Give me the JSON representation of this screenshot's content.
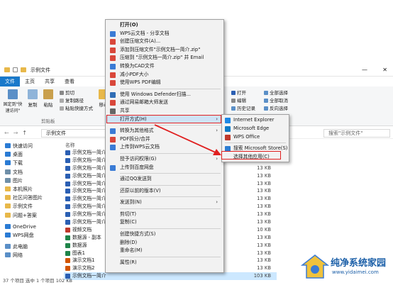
{
  "window": {
    "title": "示例文件",
    "tabs": [
      "文件",
      "主页",
      "共享",
      "查看"
    ]
  },
  "ribbon": {
    "pin_label": "固定到\"快速访问\"",
    "copy_label": "复制",
    "paste_label": "粘贴",
    "copy_path_label": "复制路径",
    "paste_shortcut_label": "粘贴快捷方式",
    "cut_label": "剪切",
    "move_label": "移动",
    "clipboard_group": "剪贴板",
    "open_label": "打开",
    "edit_label": "编辑",
    "history_label": "历史记录",
    "select_all_label": "全部选择",
    "select_none_label": "全部取消",
    "invert_label": "反向选择",
    "select_group": "选择"
  },
  "address": {
    "path": "示例文件",
    "search_placeholder": "搜索\"示例文件\""
  },
  "sidebar": {
    "items": [
      {
        "label": "快速访问",
        "color": "#2a7bd4"
      },
      {
        "label": "桌面",
        "color": "#2a7bd4"
      },
      {
        "label": "下载",
        "color": "#2a7bd4"
      },
      {
        "label": "文档",
        "color": "#6f8fa8"
      },
      {
        "label": "图片",
        "color": "#6f8fa8"
      },
      {
        "label": "本机照片",
        "color": "#e8b84a"
      },
      {
        "label": "社区问答图片",
        "color": "#e8b84a"
      },
      {
        "label": "示例文件",
        "color": "#e8b84a"
      },
      {
        "label": "问题+答案",
        "color": "#e8b84a"
      },
      {
        "label": "OneDrive",
        "color": "#2a7bd4"
      },
      {
        "label": "WPS网盘",
        "color": "#2a7bd4"
      },
      {
        "label": "此电脑",
        "color": "#5a8fc7"
      },
      {
        "label": "网络",
        "color": "#5a8fc7"
      }
    ]
  },
  "files": {
    "header": "名称",
    "rows": [
      {
        "name": "示例文档一简介",
        "size": "13 KB",
        "color": "#2b5fb3"
      },
      {
        "name": "示例文档一简介",
        "size": "13 KB",
        "color": "#2b5fb3"
      },
      {
        "name": "示例文档一简介",
        "size": "13 KB",
        "color": "#2b5fb3"
      },
      {
        "name": "示例文档一简介",
        "size": "13 KB",
        "color": "#2b5fb3"
      },
      {
        "name": "示例文档一简介",
        "size": "13 KB",
        "color": "#2b5fb3"
      },
      {
        "name": "示例文档一简介",
        "size": "13 KB",
        "color": "#2b5fb3"
      },
      {
        "name": "示例文档一简介",
        "size": "13 KB",
        "color": "#2b5fb3"
      },
      {
        "name": "示例文档一简介",
        "size": "13 KB",
        "color": "#2b5fb3"
      },
      {
        "name": "示例文档一简介",
        "size": "13 KB",
        "color": "#2b5fb3"
      },
      {
        "name": "示例文档一简介",
        "size": "13 KB",
        "color": "#2b5fb3"
      },
      {
        "name": "视频文档",
        "size": "10 KB",
        "color": "#c0392b"
      },
      {
        "name": "数据源 - 副本",
        "size": "13 KB",
        "color": "#1e8449"
      },
      {
        "name": "数据源",
        "size": "13 KB",
        "color": "#1e8449"
      },
      {
        "name": "图表1",
        "size": "13 KB",
        "color": "#1e8449"
      },
      {
        "name": "演示文档1",
        "size": "13 KB",
        "color": "#d35400"
      },
      {
        "name": "演示文档2",
        "size": "13 KB",
        "color": "#d35400"
      },
      {
        "name": "示例文档一简介",
        "size": "103 KB",
        "color": "#2b5fb3"
      }
    ]
  },
  "status": {
    "text": "37 个项目    选中 1 个项目  102 KB"
  },
  "context_menu": {
    "items": [
      {
        "label": "打开(O)",
        "color": "",
        "type": "bold"
      },
      {
        "label": "WPS云文档 - 分享文档",
        "color": "#3a7bd5"
      },
      {
        "label": "创建压缩文件(A)...",
        "color": "#d9473a"
      },
      {
        "label": "添加到压缩文件\"示例文档一简介.zip\"",
        "color": "#d9473a"
      },
      {
        "label": "压缩到 \"示例文档一简介.zip\" 并 Email",
        "color": "#d9473a"
      },
      {
        "label": "转换为CAD文件",
        "color": "#3a7bd5"
      },
      {
        "label": "减小PDF大小",
        "color": "#d9473a"
      },
      {
        "label": "使用WPS PDF编辑",
        "color": "#d9473a"
      },
      {
        "sep": true
      },
      {
        "label": "使用 Windows Defender扫描...",
        "color": "#2f6db5"
      },
      {
        "label": "通过网易邮箱大师发送",
        "color": "#d9473a"
      },
      {
        "label": "共享",
        "color": "#666666"
      },
      {
        "label": "打开方式(H)",
        "color": "",
        "arrow": true,
        "hl": true
      },
      {
        "sep": true
      },
      {
        "label": "转换为其他格式",
        "color": "#3a7bd5",
        "arrow": true
      },
      {
        "label": "PDF拆分/合并",
        "color": "#d9473a"
      },
      {
        "label": "上传到WPS云文档",
        "color": "#3a7bd5"
      },
      {
        "sep": true
      },
      {
        "label": "授予访问权限(G)",
        "color": "",
        "arrow": true
      },
      {
        "label": "上传到百度网盘",
        "color": "#3a7bd5"
      },
      {
        "sep": true
      },
      {
        "label": "通过QQ发送到",
        "color": ""
      },
      {
        "sep": true
      },
      {
        "label": "还原以前的版本(V)",
        "color": ""
      },
      {
        "sep": true
      },
      {
        "label": "发送到(N)",
        "color": "",
        "arrow": true
      },
      {
        "sep": true
      },
      {
        "label": "剪切(T)",
        "color": ""
      },
      {
        "label": "复制(C)",
        "color": ""
      },
      {
        "sep": true
      },
      {
        "label": "创建快捷方式(S)",
        "color": ""
      },
      {
        "label": "删除(D)",
        "color": ""
      },
      {
        "label": "重命名(M)",
        "color": ""
      },
      {
        "sep": true
      },
      {
        "label": "属性(R)",
        "color": ""
      }
    ]
  },
  "submenu": {
    "items": [
      {
        "label": "Internet Explorer",
        "color": "#1e88e5"
      },
      {
        "label": "Microsoft Edge",
        "color": "#0f7ac6"
      },
      {
        "label": "WPS Office",
        "color": "#c0392b"
      },
      {
        "sep": true
      },
      {
        "label": "搜索 Microsoft Store(S)",
        "color": "#2d7dd2"
      },
      {
        "label": "选择其他应用(C)",
        "color": ""
      }
    ]
  },
  "watermark": {
    "title": "纯净系统家园",
    "url": "www.yidaimei.com"
  },
  "colors": {
    "accent": "#1979ca",
    "highlight": "#e02020"
  }
}
